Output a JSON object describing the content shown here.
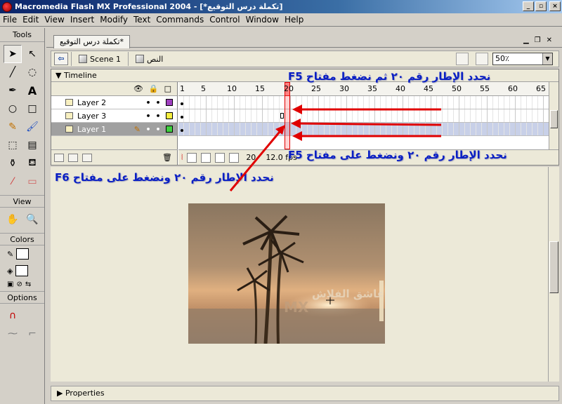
{
  "window": {
    "title": "Macromedia Flash MX Professional 2004 - [*تكملة درس التوقيع]",
    "buttons": [
      "_",
      "▫",
      "×"
    ]
  },
  "menu": [
    "File",
    "Edit",
    "View",
    "Insert",
    "Modify",
    "Text",
    "Commands",
    "Control",
    "Window",
    "Help"
  ],
  "tools_panel": {
    "title": "Tools",
    "view_label": "View",
    "colors_label": "Colors",
    "options_label": "Options"
  },
  "document": {
    "tab_label": "تكملة درس التوقيع*",
    "scene_label": "Scene 1",
    "symbol_label": "النص",
    "zoom": "50٪"
  },
  "timeline": {
    "title": "Timeline",
    "layers": [
      {
        "name": "Layer 2",
        "color": "#a040c0"
      },
      {
        "name": "Layer 3",
        "color": "#f8f040"
      },
      {
        "name": "Layer 1",
        "color": "#40d040"
      }
    ],
    "ruler_ticks": [
      "1",
      "5",
      "10",
      "15",
      "20",
      "25",
      "30",
      "35",
      "40",
      "45",
      "50",
      "55",
      "60",
      "65"
    ],
    "current_frame": "20",
    "fps": "12.0 fps"
  },
  "annotations": {
    "top": "نحدد الإطار رقم ٢٠ ثم نضغط مفتاح",
    "top_key": "F5",
    "middle": "نحدد الإطار رقم ٢٠ ونضغط على مفتاح",
    "middle_key": "F5",
    "stage": "نحدد الإطار رقم ٢٠ ونضغط على مفتاح",
    "stage_key": "F6"
  },
  "movie": {
    "watermark": "عاشق الفلاش",
    "mx_text": "MX"
  },
  "properties_label": "Properties"
}
